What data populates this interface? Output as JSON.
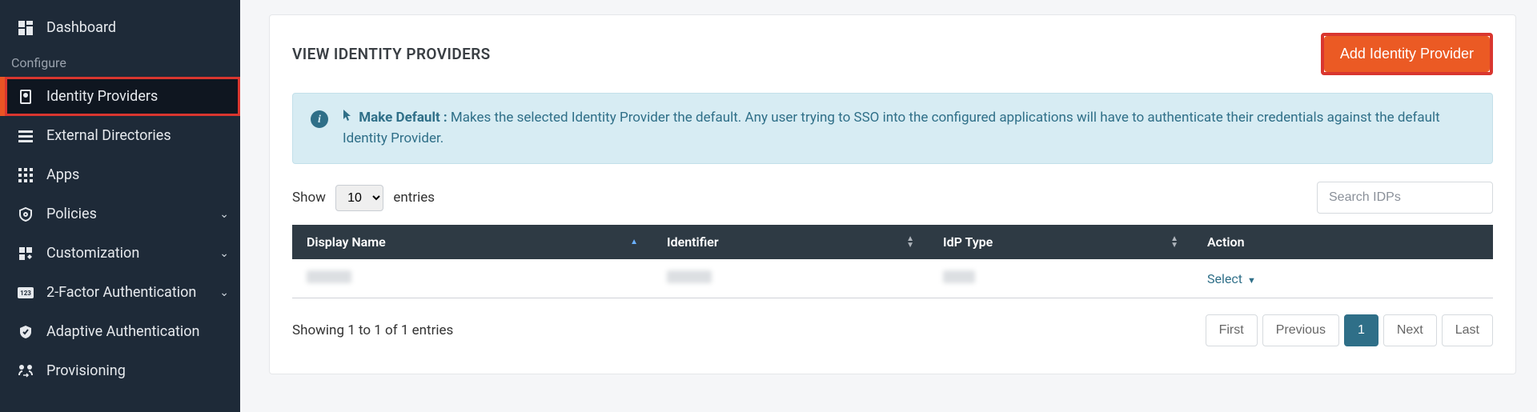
{
  "sidebar": {
    "items": [
      {
        "label": "Dashboard",
        "icon": "dashboard"
      },
      {
        "label": "Identity Providers",
        "icon": "idp",
        "active": true,
        "highlighted": true
      },
      {
        "label": "External Directories",
        "icon": "list"
      },
      {
        "label": "Apps",
        "icon": "grid"
      },
      {
        "label": "Policies",
        "icon": "shield-gear",
        "chevron": true
      },
      {
        "label": "Customization",
        "icon": "puzzle",
        "chevron": true
      },
      {
        "label": "2-Factor Authentication",
        "icon": "badge-123",
        "chevron": true
      },
      {
        "label": "Adaptive Authentication",
        "icon": "shield-check"
      },
      {
        "label": "Provisioning",
        "icon": "users-exchange"
      }
    ],
    "section_label": "Configure"
  },
  "main": {
    "title": "VIEW IDENTITY PROVIDERS",
    "add_button": "Add Identity Provider",
    "info": {
      "lead": "Make Default :",
      "body": " Makes the selected Identity Provider the default. Any user trying to SSO into the configured applications will have to authenticate their credentials against the default Identity Provider."
    },
    "show_label_prefix": "Show",
    "show_label_suffix": "entries",
    "show_value": "10",
    "search_placeholder": "Search IDPs",
    "columns": {
      "display_name": "Display Name",
      "identifier": "Identifier",
      "idp_type": "IdP Type",
      "action": "Action"
    },
    "rows": [
      {
        "display_name": "",
        "identifier": "",
        "idp_type": "",
        "action_label": "Select"
      }
    ],
    "footer_info": "Showing 1 to 1 of 1 entries",
    "pagination": {
      "first": "First",
      "previous": "Previous",
      "page": "1",
      "next": "Next",
      "last": "Last"
    }
  }
}
